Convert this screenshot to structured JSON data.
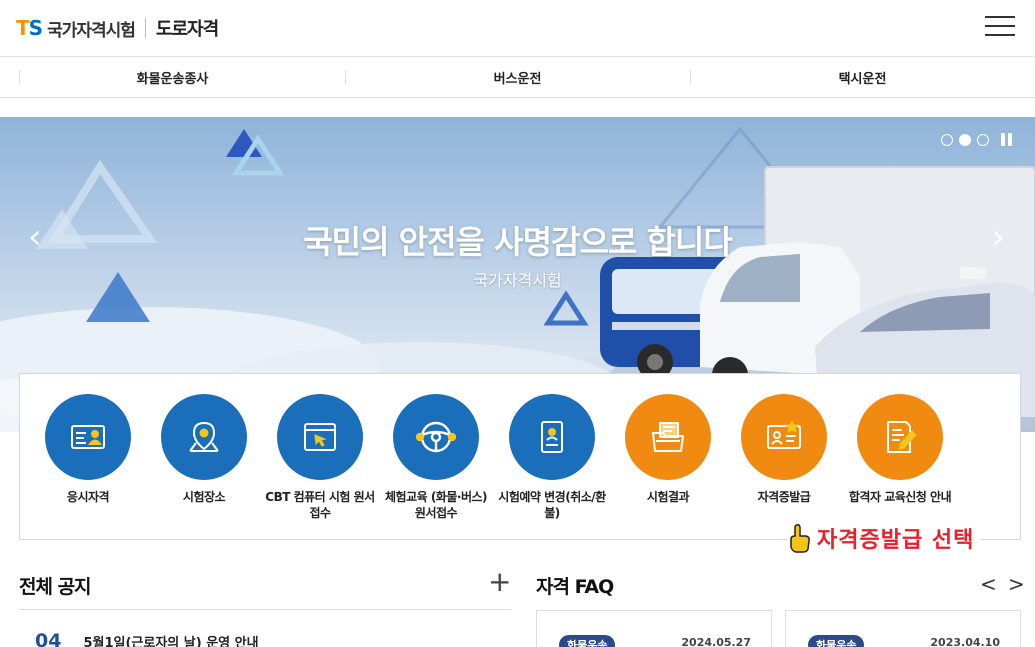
{
  "header": {
    "logo_t": "T",
    "logo_s": "S",
    "logo_name": "국가자격시험",
    "logo_sub": "도로자격"
  },
  "nav": {
    "items": [
      "화물운송종사",
      "버스운전",
      "택시운전"
    ]
  },
  "banner": {
    "title": "국민의 안전을 사명감으로 합니다",
    "subtitle": "국가자격시험",
    "prev_icon": "chevron-left-icon",
    "next_icon": "chevron-right-icon",
    "slide_count": 3,
    "active_slide": 2
  },
  "quick_menu": {
    "items": [
      {
        "label": "응시자격",
        "icon": "id-card-icon",
        "color": "#1b6fba"
      },
      {
        "label": "시험장소",
        "icon": "map-pin-icon",
        "color": "#1b6fba"
      },
      {
        "label": "CBT 컴퓨터 시험 원서접수",
        "icon": "browser-cursor-icon",
        "color": "#1b6fba"
      },
      {
        "label": "체험교육 (화물·버스) 원서접수",
        "icon": "steering-wheel-icon",
        "color": "#1b6fba"
      },
      {
        "label": "시험예약 변경(취소/환불)",
        "icon": "badge-icon",
        "color": "#1b6fba"
      },
      {
        "label": "시험결과",
        "icon": "folder-doc-icon",
        "color": "#f08a10"
      },
      {
        "label": "자격증발급",
        "icon": "license-card-icon",
        "color": "#f08a10"
      },
      {
        "label": "합격자 교육신청 안내",
        "icon": "doc-pen-icon",
        "color": "#f08a10"
      }
    ]
  },
  "callout": {
    "text": "자격증발급 선택",
    "color": "#e8202a"
  },
  "notice": {
    "title": "전체 공지",
    "more": "+",
    "rows": [
      {
        "day": "04",
        "text": "5월1일(근로자의 날) 운영 안내"
      }
    ]
  },
  "faq": {
    "title": "자격 FAQ",
    "prev": "<",
    "next": ">",
    "cards": [
      {
        "badge": "화물운송",
        "date": "2024.05.27"
      },
      {
        "badge": "화물운송",
        "date": "2023.04.10"
      }
    ]
  }
}
